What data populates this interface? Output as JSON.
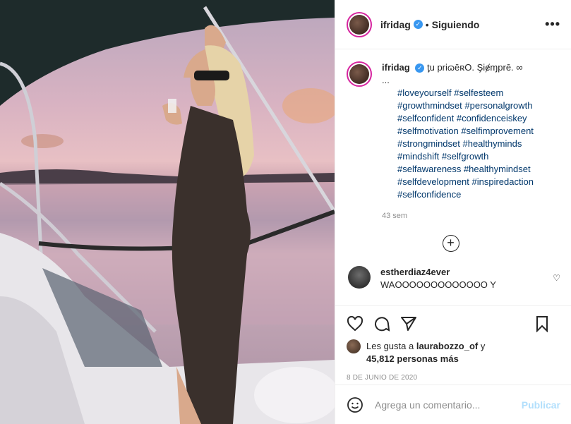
{
  "post": {
    "image_alt": "Mujer de pie en la proa de un barco al atardecer",
    "username": "ifridag",
    "follow_separator": "•",
    "follow_state": "Siguiendo"
  },
  "caption": {
    "username": "ifridag",
    "text": "ƫu priɷēʀO. Şiɇɱprē. ∞",
    "ellipsis": "...",
    "hashtags": "#loveyourself #selfesteem #growthmindset #personalgrowth #selfconfident #confidenceiskey #selfmotivation #selfimprovement #strongmindset #healthyminds #mindshift #selfgrowth #selfawareness #healthymindset #selfdevelopment #inspiredaction #selfconfidence",
    "time": "43 sem"
  },
  "comment": {
    "username": "estherdiaz4ever",
    "text": "WAOOOOOOOOOOOOO Y"
  },
  "likes": {
    "prefix": "Les gusta a",
    "user": "laurabozzo_of",
    "conj": "y",
    "count": "45,812 personas más"
  },
  "date": "8 DE JUNIO DE 2020",
  "add_comment": {
    "placeholder": "Agrega un comentario...",
    "button": "Publicar"
  }
}
